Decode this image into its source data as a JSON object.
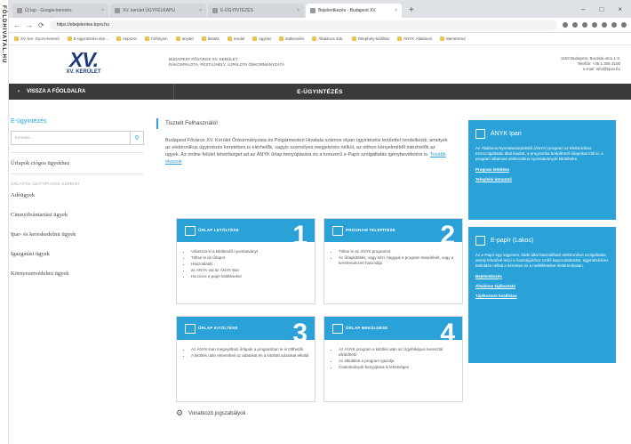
{
  "watermark": "FÖLDHIVATAL.HU",
  "browser": {
    "tabs": [
      {
        "label": "Új lap - Google-keresés",
        "active": false
      },
      {
        "label": "XV. kerület ÜGYFÉLKAPU",
        "active": false
      },
      {
        "label": "E-ÜGYINTÉZÉS",
        "active": false
      },
      {
        "label": "Bejelentkezés - Budapest XV.",
        "active": true
      }
    ],
    "url": "https://ebejelentes.bpxv.hu",
    "bookmarks": [
      "XV. ker. Gyors-kereső",
      "E-ügyintézési ebe...",
      "népszer",
      "hírfolyam",
      "anyakl",
      "iktatás",
      "rendel",
      "ügyirat",
      "iratkezelés",
      "Általános dok.",
      "Telephely-kiállítás",
      "ÁNYK Általános",
      "Menetrend"
    ]
  },
  "header": {
    "logo_mark": "XV.",
    "logo_sub": "XV. KERÜLET",
    "org_line1": "BUDAPEST FŐVÁROS XV. KERÜLET",
    "org_line2": "RÁKOSPALOTA, PESTÚJHELY, ÚJPALOTA ÖNKORMÁNYZATA",
    "contact_line1": "1153 Budapest, Bocskai utca 1-3.",
    "contact_line2": "Telefon: +36 1 305 3100",
    "contact_line3": "e-mail: info@bpxv.hu"
  },
  "navbar": {
    "back_label": "VISSZA A FŐOLDALRA",
    "title": "E-ÜGYINTÉZÉS"
  },
  "sidebar": {
    "title": "E-ügyintézés",
    "search_placeholder": "Keresés...",
    "link": "Űrlapok ciógos ügyekhez",
    "section_title": "ŰRLAPOK ÜGYTÍPUSOK SZERINT",
    "items": [
      "Adóügyek",
      "Címnyilvántartási ügyek",
      "Ipar- és kereskedelmi ügyek",
      "Igazgatási ügyek",
      "Környezetvédelmi ügyek"
    ]
  },
  "main": {
    "title": "Tisztelt Felhasználó!",
    "intro": "Budapest Főváros XV. Kerület Önkormányzata és Polgármesteri Hivatala számos olyan ügyintézési területtel rendelkezik, amelyek az elektronikus ügyintézés keretében is elérhetők, vagyis személyes megjelenés nélkül, az otthon kényelméből intézhetők az ügyek. Az online felület lehetőséget ad az ÁNYK űrlap benyújtására és a korszerű e-Papír szolgáltatás igénybevételére is.",
    "intro_link": "Tovább olvasok",
    "cards": [
      {
        "label": "ŰRLAP LETÖLTÉSE",
        "num": "1",
        "items": [
          "Válassza ki a kitöltendő nyomtatványt",
          "Töltse le az űrlapot",
          "Használatát:",
          "az ÁNYK-val az ÁNYK-ban",
          "Ha nincs e-papír kitöltésekor"
        ]
      },
      {
        "label": "PROGRAM TELEPÍTÉSE",
        "num": "2",
        "items": [
          "Töltse le az ÁNYK programot",
          "Az űrlapkitöltés, vagy kézi, hagyjuk a program telepítését, vagy a keretrendszert használja"
        ]
      },
      {
        "label": "ŰRLAP KITÖLTÉSE",
        "num": "3",
        "items": [
          "Az ÁNYK-ban megnyitható űrlapok a programban le is tölthetők",
          "A kitöltés után elmentheti az adatokat és a kitöltött adatokat elküldi"
        ]
      },
      {
        "label": "ŰRLAP BEKÜLDÉSE",
        "num": "4",
        "items": [
          "Az ÁNYK program a kitöltés után az Ügyfélkapun keresztül elküldhető",
          "Az elküldést a program igazolja",
          "Csatolmányok benyújtása is lehetséges"
        ]
      }
    ],
    "footer_link": "Vonatkozó jogszabályok"
  },
  "right": {
    "panel1": {
      "title": "ÁNYK Ipari",
      "text": "Az Általános Nyomtatványkitöltő (ÁNYK) program az Elektronikus Közszolgáltatás által kiadott, a programba beépíthető űrlapokat tölti ki, a program alkalmas elektronikus nyomtatványok kitöltésére.",
      "links": [
        "Program letöltése",
        "Telepítési útmutató"
      ]
    },
    "panel2": {
      "title": "E-papír (Lakos)",
      "text": "Az e-Papír egy ingyenes, bárki által használható elektronikus szolgáltatás, amely lehetővé teszi a hatóságokhoz szóló kapcsolattartást, ügyintézéshez beküldés nélkül a kérelmet és a mellékleteket elektronikusan.",
      "links": [
        "Bejelentkezés",
        "Általános tájékoztató",
        "Tájékoztató beállítása"
      ]
    }
  }
}
